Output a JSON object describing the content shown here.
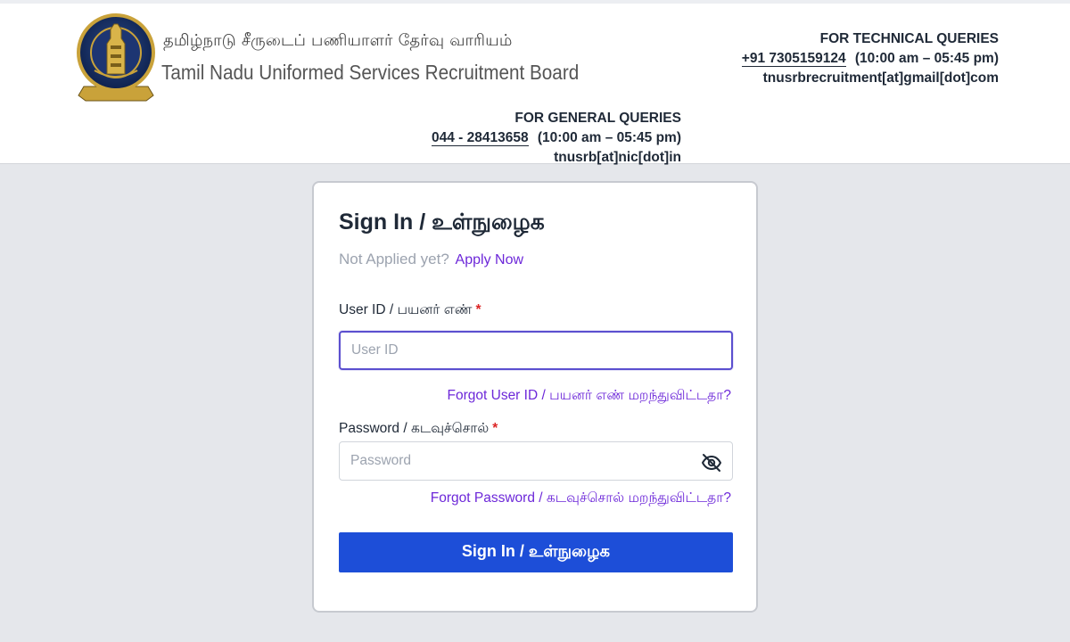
{
  "header": {
    "org_name_tamil": "தமிழ்நாடு சீருடைப் பணியாளர் தேர்வு வாரியம்",
    "org_name_english": "Tamil Nadu Uniformed Services Recruitment Board",
    "technical": {
      "title": "FOR TECHNICAL QUERIES",
      "phone": "+91 7305159124",
      "hours": "(10:00 am – 05:45 pm)",
      "email": "tnusrbrecruitment[at]gmail[dot]com"
    },
    "general": {
      "title": "FOR GENERAL QUERIES",
      "phone": "044 - 28413658",
      "hours": "(10:00 am – 05:45 pm)",
      "email": "tnusrb[at]nic[dot]in"
    }
  },
  "login": {
    "title": "Sign In / உள்நுழைக",
    "not_applied": "Not Applied yet?",
    "apply_now": "Apply Now",
    "user_id_label": "User ID / பயனர் எண்",
    "user_id_placeholder": "User ID",
    "user_id_value": "",
    "forgot_user_id": "Forgot User ID / பயனர் எண் மறந்துவிட்டதா?",
    "password_label": "Password / கடவுச்சொல்",
    "password_placeholder": "Password",
    "password_value": "",
    "forgot_password": "Forgot Password / கடவுச்சொல் மறந்துவிட்டதா?",
    "required_mark": "*",
    "sign_in_button": "Sign In / உள்நுழைக"
  },
  "colors": {
    "primary_button": "#1d4ed8",
    "link": "#6d28d9",
    "required": "#dc2626",
    "focus_border": "#5b4fcf",
    "page_bg": "#e5e7eb"
  },
  "icons": {
    "emblem": "tamil-nadu-emblem-icon",
    "password_toggle": "eye-slash-icon"
  }
}
